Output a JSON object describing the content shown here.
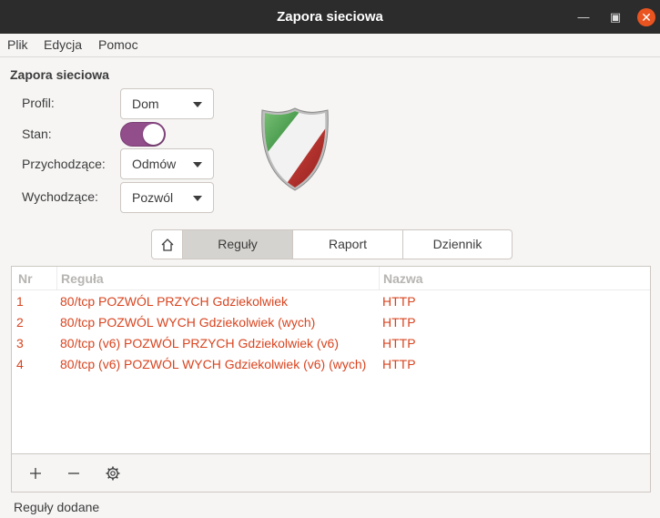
{
  "window": {
    "title": "Zapora sieciowa"
  },
  "menu": {
    "file": "Plik",
    "edit": "Edycja",
    "help": "Pomoc"
  },
  "section_title": "Zapora sieciowa",
  "profile": {
    "label": "Profil:",
    "value": "Dom"
  },
  "status_toggle": {
    "label": "Stan:",
    "on": true
  },
  "incoming": {
    "label": "Przychodzące:",
    "value": "Odmów"
  },
  "outgoing": {
    "label": "Wychodzące:",
    "value": "Pozwól"
  },
  "tabs": [
    {
      "label": "Reguły",
      "active": true
    },
    {
      "label": "Raport",
      "active": false
    },
    {
      "label": "Dziennik",
      "active": false
    }
  ],
  "table": {
    "headers": {
      "nr": "Nr",
      "rule": "Reguła",
      "name": "Nazwa"
    },
    "rows": [
      {
        "nr": "1",
        "rule": "80/tcp POZWÓL PRZYCH Gdziekolwiek",
        "name": "HTTP"
      },
      {
        "nr": "2",
        "rule": "80/tcp POZWÓL WYCH Gdziekolwiek (wych)",
        "name": "HTTP"
      },
      {
        "nr": "3",
        "rule": "80/tcp (v6) POZWÓL PRZYCH Gdziekolwiek (v6)",
        "name": "HTTP"
      },
      {
        "nr": "4",
        "rule": "80/tcp (v6) POZWÓL WYCH Gdziekolwiek (v6) (wych)",
        "name": "HTTP"
      }
    ]
  },
  "statusbar": "Reguły dodane",
  "colors": {
    "accent": "#924d8b",
    "rule_text": "#d8441f",
    "close": "#e95420"
  }
}
